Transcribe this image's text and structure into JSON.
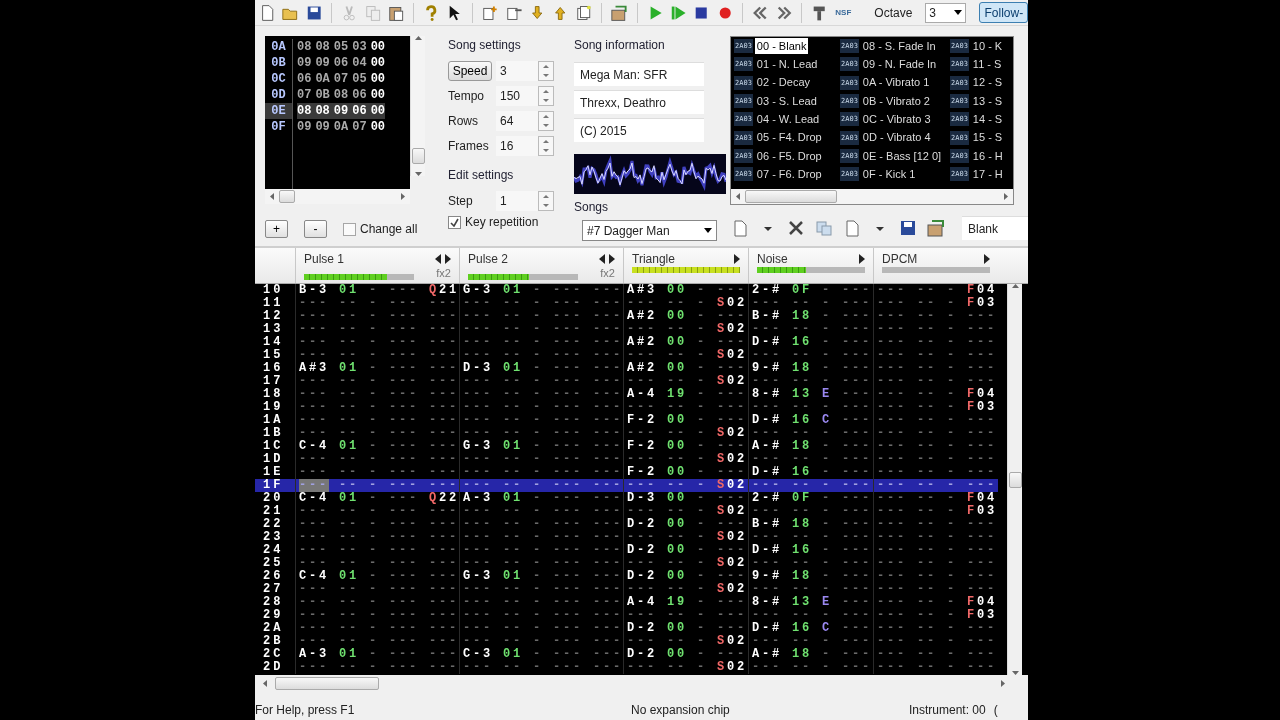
{
  "toolbar": {
    "export_label": "NSF",
    "octave_label": "Octave",
    "octave_value": "3",
    "follow_label": "Follow-"
  },
  "frames": {
    "rows": [
      {
        "label": "0A",
        "values": [
          "08",
          "08",
          "05",
          "03",
          "00"
        ],
        "selected": false
      },
      {
        "label": "0B",
        "values": [
          "09",
          "09",
          "06",
          "04",
          "00"
        ],
        "selected": false
      },
      {
        "label": "0C",
        "values": [
          "06",
          "0A",
          "07",
          "05",
          "00"
        ],
        "selected": false
      },
      {
        "label": "0D",
        "values": [
          "07",
          "0B",
          "08",
          "06",
          "00"
        ],
        "selected": false
      },
      {
        "label": "0E",
        "values": [
          "08",
          "08",
          "09",
          "06",
          "00"
        ],
        "selected": true
      },
      {
        "label": "0F",
        "values": [
          "09",
          "09",
          "0A",
          "07",
          "00"
        ],
        "selected": false
      }
    ],
    "add_label": "+",
    "remove_label": "-",
    "change_all": {
      "label": "Change all",
      "checked": false
    }
  },
  "song_settings": {
    "title": "Song settings",
    "fields": [
      {
        "kind": "button",
        "label": "Speed",
        "value": "3"
      },
      {
        "kind": "label",
        "label": "Tempo",
        "value": "150"
      },
      {
        "kind": "label",
        "label": "Rows",
        "value": "64"
      },
      {
        "kind": "label",
        "label": "Frames",
        "value": "16"
      }
    ]
  },
  "edit_settings": {
    "title": "Edit settings",
    "step_label": "Step",
    "step_value": "1",
    "key_repetition": {
      "label": "Key repetition",
      "checked": true
    }
  },
  "song_information": {
    "title": "Song information",
    "fields": [
      "Mega Man: SFR",
      "Threxx, Deathro",
      "(C) 2015"
    ]
  },
  "songs": {
    "label": "Songs",
    "value": "#7 Dagger Man"
  },
  "instruments": {
    "items": [
      {
        "chip": "2A03",
        "name": "00 - Blank",
        "selected": true
      },
      {
        "chip": "2A03",
        "name": "01 - N. Lead",
        "selected": false
      },
      {
        "chip": "2A03",
        "name": "02 - Decay",
        "selected": false
      },
      {
        "chip": "2A03",
        "name": "03 - S. Lead",
        "selected": false
      },
      {
        "chip": "2A03",
        "name": "04 - W. Lead",
        "selected": false
      },
      {
        "chip": "2A03",
        "name": "05 - F4. Drop",
        "selected": false
      },
      {
        "chip": "2A03",
        "name": "06 - F5. Drop",
        "selected": false
      },
      {
        "chip": "2A03",
        "name": "07 - F6. Drop",
        "selected": false
      },
      {
        "chip": "2A03",
        "name": "08 - S. Fade In",
        "selected": false
      },
      {
        "chip": "2A03",
        "name": "09 - N. Fade In",
        "selected": false
      },
      {
        "chip": "2A03",
        "name": "0A - Vibrato 1",
        "selected": false
      },
      {
        "chip": "2A03",
        "name": "0B - Vibrato 2",
        "selected": false
      },
      {
        "chip": "2A03",
        "name": "0C - Vibrato 3",
        "selected": false
      },
      {
        "chip": "2A03",
        "name": "0D - Vibrato 4",
        "selected": false
      },
      {
        "chip": "2A03",
        "name": "0E - Bass [12 0]",
        "selected": false
      },
      {
        "chip": "2A03",
        "name": "0F - Kick 1",
        "selected": false
      },
      {
        "chip": "2A03",
        "name": "10 - K",
        "selected": false
      },
      {
        "chip": "2A03",
        "name": "11 - S",
        "selected": false
      },
      {
        "chip": "2A03",
        "name": "12 - S",
        "selected": false
      },
      {
        "chip": "2A03",
        "name": "13 - S",
        "selected": false
      },
      {
        "chip": "2A03",
        "name": "14 - S",
        "selected": false
      },
      {
        "chip": "2A03",
        "name": "15 - S",
        "selected": false
      },
      {
        "chip": "2A03",
        "name": "16 - H",
        "selected": false
      },
      {
        "chip": "2A03",
        "name": "17 - H",
        "selected": false
      }
    ],
    "name_field": "Blank"
  },
  "channels": [
    {
      "name": "Pulse 1",
      "fx_label": "fx2",
      "level": 0.75
    },
    {
      "name": "Pulse 2",
      "fx_label": "fx2",
      "level": 0.55
    },
    {
      "name": "Triangle",
      "level": 1.0
    },
    {
      "name": "Noise",
      "level": 0.45
    },
    {
      "name": "DPCM",
      "level": 0
    }
  ],
  "pattern_rows": [
    {
      "label": "10",
      "selected": false,
      "cells": [
        "B-3 01 - --- Q21",
        "G-3 01 - --- ---",
        "A#3 00 - ---",
        "2-# 0F - ---",
        "--- -- - F04"
      ]
    },
    {
      "label": "11",
      "selected": false,
      "cells": [
        "--- -- - --- ---",
        "--- -- - --- ---",
        "--- -- - S02",
        "--- -- - ---",
        "--- -- - F03"
      ]
    },
    {
      "label": "12",
      "selected": false,
      "cells": [
        "--- -- - --- ---",
        "--- -- - --- ---",
        "A#2 00 - ---",
        "B-# 18 - ---",
        "--- -- - ---"
      ]
    },
    {
      "label": "13",
      "selected": false,
      "cells": [
        "--- -- - --- ---",
        "--- -- - --- ---",
        "--- -- - S02",
        "--- -- - ---",
        "--- -- - ---"
      ]
    },
    {
      "label": "14",
      "selected": false,
      "cells": [
        "--- -- - --- ---",
        "--- -- - --- ---",
        "A#2 00 - ---",
        "D-# 16 - ---",
        "--- -- - ---"
      ]
    },
    {
      "label": "15",
      "selected": false,
      "cells": [
        "--- -- - --- ---",
        "--- -- - --- ---",
        "--- -- - S02",
        "--- -- - ---",
        "--- -- - ---"
      ]
    },
    {
      "label": "16",
      "selected": false,
      "cells": [
        "A#3 01 - --- ---",
        "D-3 01 - --- ---",
        "A#2 00 - ---",
        "9-# 18 - ---",
        "--- -- - ---"
      ]
    },
    {
      "label": "17",
      "selected": false,
      "cells": [
        "--- -- - --- ---",
        "--- -- - --- ---",
        "--- -- - S02",
        "--- -- - ---",
        "--- -- - ---"
      ]
    },
    {
      "label": "18",
      "selected": false,
      "cells": [
        "--- -- - --- ---",
        "--- -- - --- ---",
        "A-4 19 - ---",
        "8-# 13 E ---",
        "--- -- - F04"
      ]
    },
    {
      "label": "19",
      "selected": false,
      "cells": [
        "--- -- - --- ---",
        "--- -- - --- ---",
        "--- -- - ---",
        "--- -- - ---",
        "--- -- - F03"
      ]
    },
    {
      "label": "1A",
      "selected": false,
      "cells": [
        "--- -- - --- ---",
        "--- -- - --- ---",
        "F-2 00 - ---",
        "D-# 16 C ---",
        "--- -- - ---"
      ]
    },
    {
      "label": "1B",
      "selected": false,
      "cells": [
        "--- -- - --- ---",
        "--- -- - --- ---",
        "--- -- - S02",
        "--- -- - ---",
        "--- -- - ---"
      ]
    },
    {
      "label": "1C",
      "selected": false,
      "cells": [
        "C-4 01 - --- ---",
        "G-3 01 - --- ---",
        "F-2 00 - ---",
        "A-# 18 - ---",
        "--- -- - ---"
      ]
    },
    {
      "label": "1D",
      "selected": false,
      "cells": [
        "--- -- - --- ---",
        "--- -- - --- ---",
        "--- -- - S02",
        "--- -- - ---",
        "--- -- - ---"
      ]
    },
    {
      "label": "1E",
      "selected": false,
      "cells": [
        "--- -- - --- ---",
        "--- -- - --- ---",
        "F-2 00 - ---",
        "D-# 16 - ---",
        "--- -- - ---"
      ]
    },
    {
      "label": "1F",
      "selected": true,
      "cells": [
        "--- -- - --- ---",
        "--- -- - --- ---",
        "--- -- - S02",
        "--- -- - ---",
        "--- -- - ---"
      ]
    },
    {
      "label": "20",
      "selected": false,
      "cells": [
        "C-4 01 - --- Q22",
        "A-3 01 - --- ---",
        "D-3 00 - ---",
        "2-# 0F - ---",
        "--- -- - F04"
      ]
    },
    {
      "label": "21",
      "selected": false,
      "cells": [
        "--- -- - --- ---",
        "--- -- - --- ---",
        "--- -- - S02",
        "--- -- - ---",
        "--- -- - F03"
      ]
    },
    {
      "label": "22",
      "selected": false,
      "cells": [
        "--- -- - --- ---",
        "--- -- - --- ---",
        "D-2 00 - ---",
        "B-# 18 - ---",
        "--- -- - ---"
      ]
    },
    {
      "label": "23",
      "selected": false,
      "cells": [
        "--- -- - --- ---",
        "--- -- - --- ---",
        "--- -- - S02",
        "--- -- - ---",
        "--- -- - ---"
      ]
    },
    {
      "label": "24",
      "selected": false,
      "cells": [
        "--- -- - --- ---",
        "--- -- - --- ---",
        "D-2 00 - ---",
        "D-# 16 - ---",
        "--- -- - ---"
      ]
    },
    {
      "label": "25",
      "selected": false,
      "cells": [
        "--- -- - --- ---",
        "--- -- - --- ---",
        "--- -- - S02",
        "--- -- - ---",
        "--- -- - ---"
      ]
    },
    {
      "label": "26",
      "selected": false,
      "cells": [
        "C-4 01 - --- ---",
        "G-3 01 - --- ---",
        "D-2 00 - ---",
        "9-# 18 - ---",
        "--- -- - ---"
      ]
    },
    {
      "label": "27",
      "selected": false,
      "cells": [
        "--- -- - --- ---",
        "--- -- - --- ---",
        "--- -- - S02",
        "--- -- - ---",
        "--- -- - ---"
      ]
    },
    {
      "label": "28",
      "selected": false,
      "cells": [
        "--- -- - --- ---",
        "--- -- - --- ---",
        "A-4 19 - ---",
        "8-# 13 E ---",
        "--- -- - F04"
      ]
    },
    {
      "label": "29",
      "selected": false,
      "cells": [
        "--- -- - --- ---",
        "--- -- - --- ---",
        "--- -- - ---",
        "--- -- - ---",
        "--- -- - F03"
      ]
    },
    {
      "label": "2A",
      "selected": false,
      "cells": [
        "--- -- - --- ---",
        "--- -- - --- ---",
        "D-2 00 - ---",
        "D-# 16 C ---",
        "--- -- - ---"
      ]
    },
    {
      "label": "2B",
      "selected": false,
      "cells": [
        "--- -- - --- ---",
        "--- -- - --- ---",
        "--- -- - S02",
        "--- -- - ---",
        "--- -- - ---"
      ]
    },
    {
      "label": "2C",
      "selected": false,
      "cells": [
        "A-3 01 - --- ---",
        "C-3 01 - --- ---",
        "D-2 00 - ---",
        "A-# 18 - ---",
        "--- -- - ---"
      ]
    },
    {
      "label": "2D",
      "selected": false,
      "cells": [
        "--- -- - --- ---",
        "--- -- - --- ---",
        "--- -- - S02",
        "--- -- - ---",
        "--- -- - ---"
      ]
    }
  ],
  "status_bar": [
    "For Help, press F1",
    "No expansion chip",
    "Instrument: 00",
    "("
  ]
}
